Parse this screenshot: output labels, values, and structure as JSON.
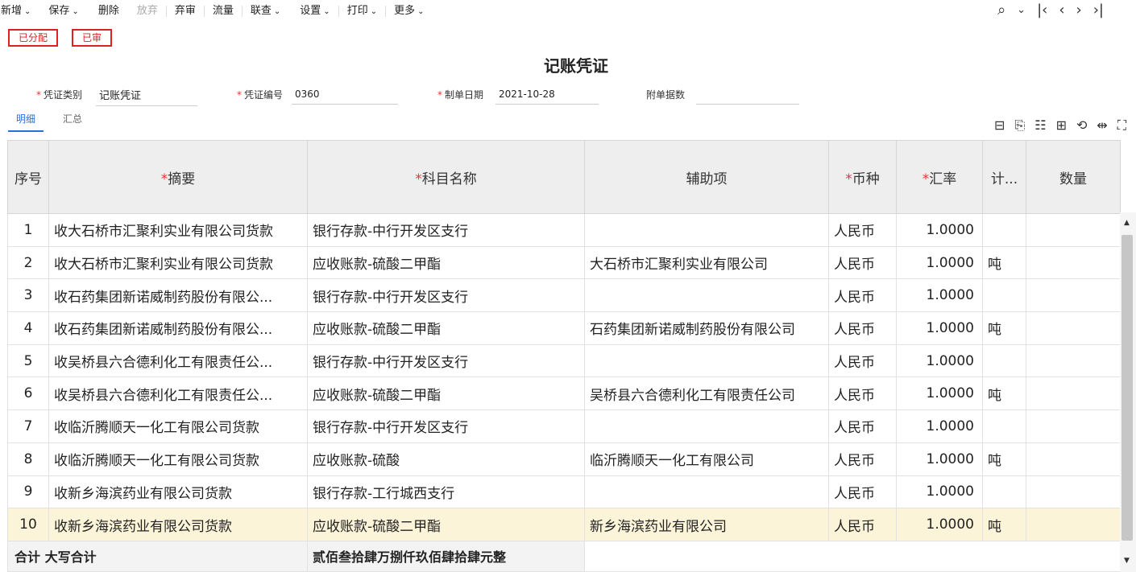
{
  "toolbar": {
    "items": [
      {
        "label": "新增",
        "caret": true,
        "disabled": false
      },
      {
        "label": "保存",
        "caret": true,
        "disabled": false
      },
      {
        "label": "删除",
        "caret": false,
        "disabled": false
      },
      {
        "label": "放弃",
        "caret": false,
        "disabled": true
      },
      {
        "label": "弃审",
        "caret": false,
        "disabled": false
      },
      {
        "label": "流量",
        "caret": false,
        "disabled": false
      },
      {
        "label": "联查",
        "caret": true,
        "disabled": false
      },
      {
        "label": "设置",
        "caret": true,
        "disabled": false
      },
      {
        "label": "打印",
        "caret": true,
        "disabled": false
      },
      {
        "label": "更多",
        "caret": true,
        "disabled": false
      }
    ]
  },
  "tags": [
    "已分配",
    "已审"
  ],
  "title": "记账凭证",
  "form": {
    "voucher_type": {
      "label": "凭证类别",
      "value": "记账凭证"
    },
    "voucher_no": {
      "label": "凭证编号",
      "value": "0360"
    },
    "date": {
      "label": "制单日期",
      "value": "2021-10-28"
    },
    "attachments": {
      "label": "附单据数",
      "value": ""
    }
  },
  "subtabs": [
    "明细",
    "汇总"
  ],
  "columns": [
    "序号",
    "摘要",
    "科目名称",
    "辅助项",
    "币种",
    "汇率",
    "计...",
    "数量"
  ],
  "rows": [
    [
      "1",
      "收大石桥市汇聚利实业有限公司货款",
      "银行存款-中行开发区支行",
      "",
      "人民币",
      "1.0000",
      "",
      ""
    ],
    [
      "2",
      "收大石桥市汇聚利实业有限公司货款",
      "应收账款-硫酸二甲酯",
      "大石桥市汇聚利实业有限公司",
      "人民币",
      "1.0000",
      "吨",
      ""
    ],
    [
      "3",
      "收石药集团新诺威制药股份有限公...",
      "银行存款-中行开发区支行",
      "",
      "人民币",
      "1.0000",
      "",
      ""
    ],
    [
      "4",
      "收石药集团新诺威制药股份有限公...",
      "应收账款-硫酸二甲酯",
      "石药集团新诺威制药股份有限公司",
      "人民币",
      "1.0000",
      "吨",
      ""
    ],
    [
      "5",
      "收吴桥县六合德利化工有限责任公...",
      "银行存款-中行开发区支行",
      "",
      "人民币",
      "1.0000",
      "",
      ""
    ],
    [
      "6",
      "收吴桥县六合德利化工有限责任公...",
      "应收账款-硫酸二甲酯",
      "吴桥县六合德利化工有限责任公司",
      "人民币",
      "1.0000",
      "吨",
      ""
    ],
    [
      "7",
      "收临沂腾顺天一化工有限公司货款",
      "银行存款-中行开发区支行",
      "",
      "人民币",
      "1.0000",
      "",
      ""
    ],
    [
      "8",
      "收临沂腾顺天一化工有限公司货款",
      "应收账款-硫酸",
      "临沂腾顺天一化工有限公司",
      "人民币",
      "1.0000",
      "吨",
      ""
    ],
    [
      "9",
      "收新乡海滨药业有限公司货款",
      "银行存款-工行城西支行",
      "",
      "人民币",
      "1.0000",
      "",
      ""
    ],
    [
      "10",
      "收新乡海滨药业有限公司货款",
      "应收账款-硫酸二甲酯",
      "新乡海滨药业有限公司",
      "人民币",
      "1.0000",
      "吨",
      ""
    ]
  ],
  "selected_row": 10,
  "total": {
    "label": "合计",
    "upper_label": "大写合计",
    "upper_amount": "贰佰叁拾肆万捌仟玖佰肆拾肆元整"
  },
  "colors": {
    "accent": "#2b6fd6",
    "tag_red": "#dd2222",
    "selected_row": "#fbf4d8",
    "header_bg": "#eeeeee"
  }
}
